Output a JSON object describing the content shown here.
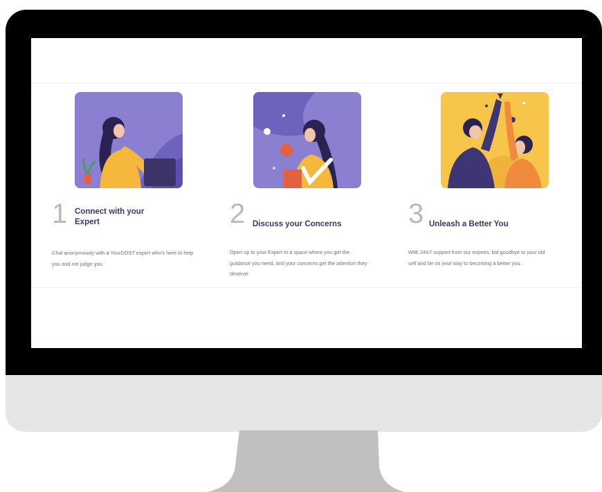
{
  "steps": [
    {
      "number": "1",
      "title": "Connect with your Expert",
      "description": "Chat anonymously with a YourDOST expert who's here to help you and not judge you.",
      "illustration": "person-with-laptop-illustration"
    },
    {
      "number": "2",
      "title": "Discuss your Concerns",
      "description": "Open up to your Expert in a space where you get the guidance you need, and your concerns get the attention they deserve.",
      "illustration": "person-holding-cup-illustration"
    },
    {
      "number": "3",
      "title": "Unleash a Better You",
      "description": "With 24X7 support from our experts, bid goodbye to your old self and be on your way to becoming a better you.",
      "illustration": "high-five-illustration"
    }
  ],
  "colors": {
    "title": "#3a3573",
    "number": "#b8b8c2",
    "text": "#707080",
    "purple": "#8a7fd0",
    "yellow": "#f7c54a",
    "bezel": "#000000",
    "chin": "#e6e6e6",
    "stand": "#c0c0c0"
  }
}
